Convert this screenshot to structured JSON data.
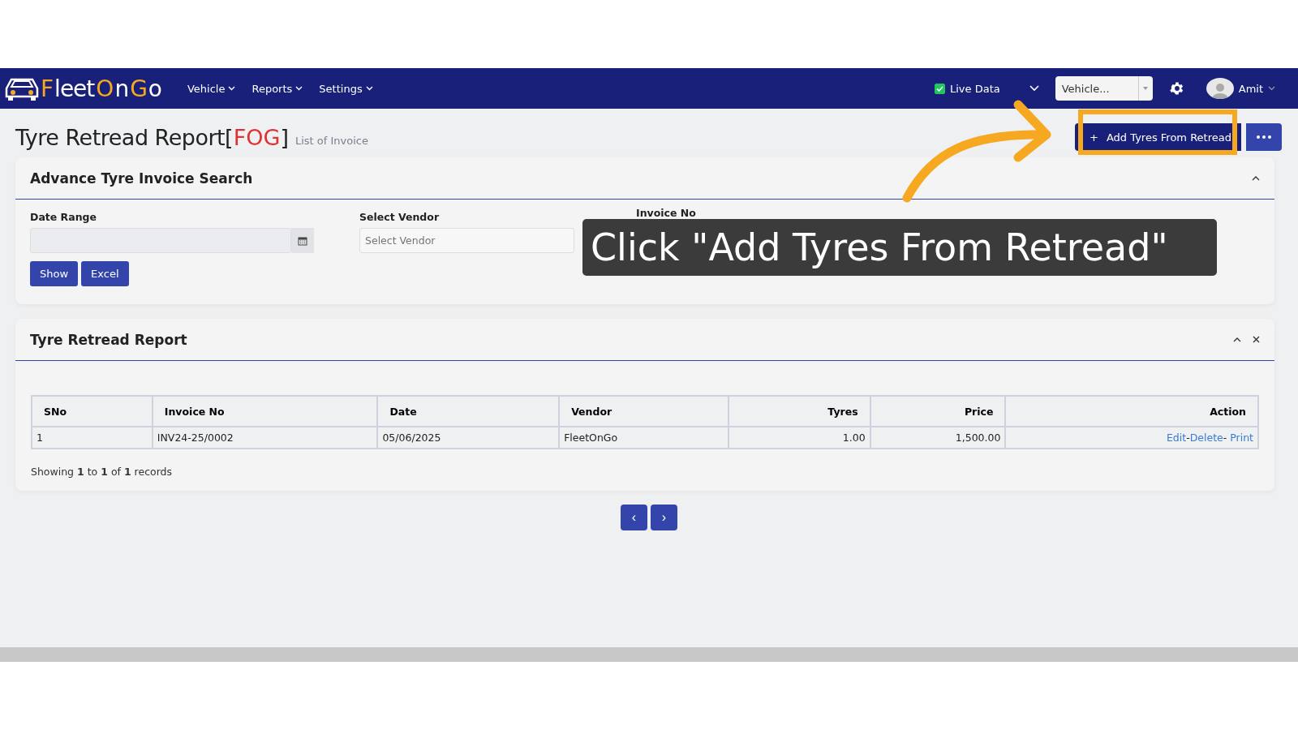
{
  "navbar": {
    "logo": [
      {
        "text": "F",
        "accent": true
      },
      {
        "text": "leet",
        "accent": false
      },
      {
        "text": "O",
        "accent": true
      },
      {
        "text": "n",
        "accent": false
      },
      {
        "text": "G",
        "accent": true
      },
      {
        "text": "o",
        "accent": false
      }
    ],
    "menus": [
      "Vehicle",
      "Reports",
      "Settings"
    ],
    "live_data": {
      "label": "Live Data",
      "checked": true
    },
    "vehicle_select": {
      "placeholder": "Vehicle..."
    },
    "user": "Amit"
  },
  "page": {
    "title": "Tyre Retread Report",
    "code_open": "[",
    "code": "FOG",
    "code_close": "]",
    "subtitle": "List of Invoice",
    "add_button": {
      "icon": "+",
      "label": "Add Tyres From Retread"
    }
  },
  "search_panel": {
    "title": "Advance Tyre Invoice Search",
    "expanded": true,
    "fields": [
      {
        "kind": "date",
        "label": "Date Range"
      },
      {
        "kind": "select",
        "label": "Select Vendor",
        "placeholder": "Select Vendor"
      },
      {
        "kind": "text",
        "label": "Invoice No"
      }
    ],
    "buttons": [
      "Show",
      "Excel"
    ]
  },
  "report_panel": {
    "title": "Tyre Retread Report",
    "expanded": true,
    "table": {
      "columns": [
        {
          "label": "SNo",
          "kind": "text"
        },
        {
          "label": "Invoice No",
          "kind": "text"
        },
        {
          "label": "Date",
          "kind": "text"
        },
        {
          "label": "Vendor",
          "kind": "text"
        },
        {
          "label": "Tyres",
          "kind": "number"
        },
        {
          "label": "Price",
          "kind": "number"
        },
        {
          "label": "Action",
          "kind": "actions"
        }
      ],
      "rows": [
        {
          "cells": [
            "1",
            "INV24-25/0002",
            "05/06/2025",
            "FleetOnGo",
            "1.00",
            "1,500.00"
          ],
          "actions": [
            "Edit",
            "Delete",
            "Print"
          ],
          "separators": [
            "-",
            "- "
          ]
        }
      ]
    },
    "footer": "Showing **1** to **1** of **1** records"
  },
  "pagination": {
    "prev": "‹",
    "next": "›"
  },
  "callout": {
    "text": "Click \"Add Tyres From Retread\""
  }
}
